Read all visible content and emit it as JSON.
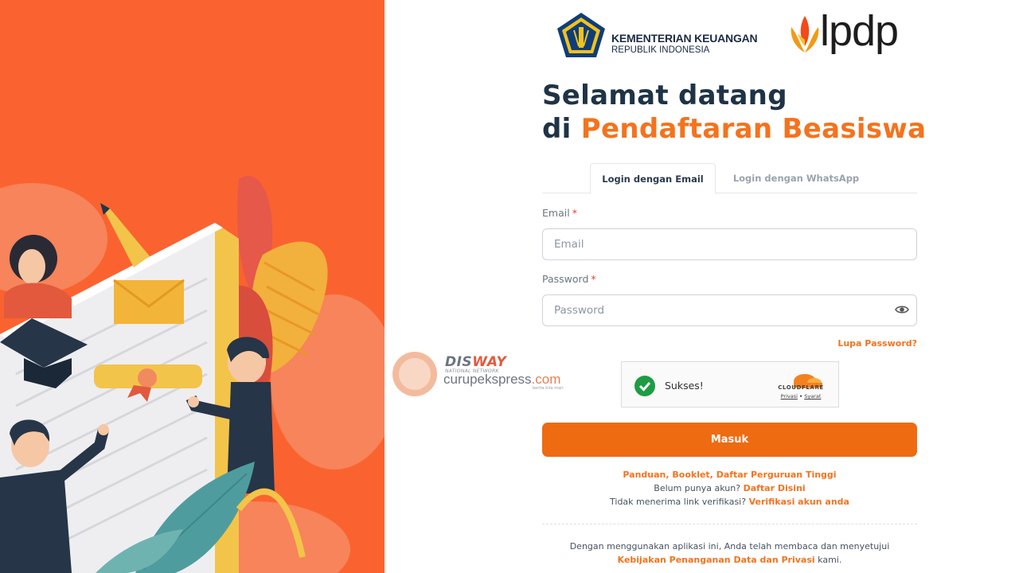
{
  "brand": {
    "ministry_name": "KEMENTERIAN KEUANGAN",
    "ministry_sub": "REPUBLIK INDONESIA",
    "lpdp_word": "lpdp"
  },
  "heading": {
    "line1": "Selamat datang",
    "line2_prefix": "di ",
    "line2_accent": "Pendaftaran Beasiswa"
  },
  "tabs": [
    {
      "label": "Login dengan Email",
      "active": true
    },
    {
      "label": "Login dengan WhatsApp",
      "active": false
    }
  ],
  "form": {
    "email_label": "Email",
    "email_placeholder": "Email",
    "email_value": "",
    "password_label": "Password",
    "password_placeholder": "Password",
    "password_value": "",
    "required_mark": "*",
    "forgot_label": "Lupa Password?",
    "submit_label": "Masuk"
  },
  "captcha": {
    "status": "Sukses!",
    "brand": "CLOUDFLARE",
    "privacy": "Privasi",
    "separator": "•",
    "terms": "Syarat"
  },
  "links": {
    "guide": "Panduan, Booklet, Daftar Perguruan Tinggi",
    "no_account_text": "Belum punya akun? ",
    "register": "Daftar Disini",
    "no_verify_text": "Tidak menerima link verifikasi? ",
    "verify": "Verifikasi akun anda"
  },
  "footer": {
    "notice": "Dengan menggunakan aplikasi ini, Anda telah membaca dan menyetujui",
    "policy": "Kebijakan Penanganan Data dan Privasi",
    "suffix": " kami."
  },
  "watermark": {
    "disway_a": "DIS",
    "disway_b": "WAY",
    "network": "NATIONAL NETWORK",
    "site_a": "curupekspress",
    "site_b": ".com",
    "tagline": "berita kita mari"
  },
  "colors": {
    "accent": "#f4731d",
    "button": "#ee6b11",
    "hero_bg": "#fa6330",
    "heading": "#1f3347"
  },
  "icons": {
    "password_toggle": "eye-icon",
    "captcha_status": "check-circle-icon"
  }
}
